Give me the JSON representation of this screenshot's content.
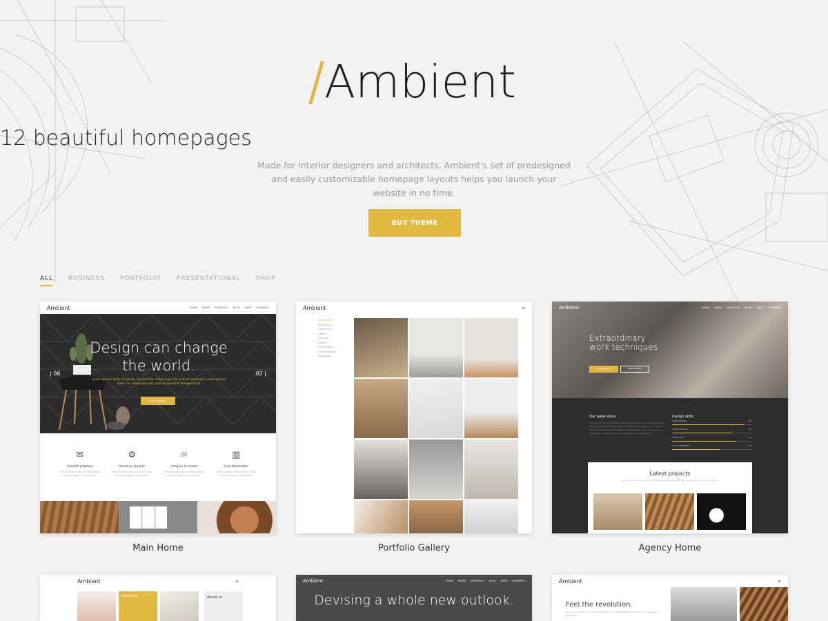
{
  "logo": "Ambient",
  "tagline": "12 beautiful homepages",
  "description": "Made for interior designers and architects, Ambient's set of predesigned and easily customizable homepage layouts helps you launch your website in no time.",
  "buy_button": "BUY THEME",
  "filters": [
    "ALL",
    "BUSINESS",
    "PORTFOLIO",
    "PRESENTATIONAL",
    "SHOP"
  ],
  "colors": {
    "accent": "#e1b840",
    "background": "#f2f2f2",
    "dark": "#2d2d2d"
  },
  "cards": [
    {
      "caption": "Main Home",
      "brand": "Ambient",
      "nav": [
        "HOME",
        "PAGES",
        "PORTFOLIO",
        "BLOG",
        "SHOP",
        "ELEMENTS"
      ],
      "hero_title": "Design can change the world.",
      "hero_sub": "Lorem ipsum dolor sit amet, consectetur adipiscing elit, sed do eiusmod. Lorem ipsum dolor Tur adipiscing elit, sed do eiusmod tempor incid",
      "hero_btn": "VIEW PROJECTS",
      "slide_left": "| 06",
      "slide_right": "02 |",
      "features": [
        {
          "icon": "envelope-icon",
          "title": "Smooth parallax",
          "text": "Proin gravida nibh vel velit auctor aliquet. Aenean sollicitudin."
        },
        {
          "icon": "gear-icon",
          "title": "Amazing layouts",
          "text": "Proin gravida nibh vel velit auctor aliquet. Aenean sollicitudin."
        },
        {
          "icon": "bulb-icon",
          "title": "Imagine & create",
          "text": "Proin gravida nibh vel velit auctor aliquet. Aenean sollicitudin."
        },
        {
          "icon": "building-icon",
          "title": "Cool shortcodes",
          "text": "Proin gravida nibh vel velit auctor aliquet. Aenean sollicitudin."
        }
      ]
    },
    {
      "caption": "Portfolio Gallery",
      "brand": "Ambient",
      "menu": [
        "Apartments",
        "Restaurant",
        "Cafe Stores",
        "Offices",
        "Dinerner",
        "Salons",
        "Public Space",
        "Contact House",
        "Showroom"
      ]
    },
    {
      "caption": "Agency Home",
      "brand": "Ambient",
      "nav": [
        "HOME",
        "PAGES",
        "PORTFOLIO",
        "BLOG",
        "SHOP",
        "ELEMENTS"
      ],
      "hero_title": "Extraordinary work techniques",
      "btn1": "VIEW PROJECTS",
      "btn2": "VIEW FEATURES",
      "story_title": "Our great story",
      "story_text": "Lorem ipsum dolor sit amet, consectetur adipiscing elit, sed do eiusmod tempor incididunt ut labore et dolore magna aliqua. Ut enim ad minim veniam, quis nostrud exercitation ullamco laboris nisi ut aliquip ex ea commodo consequat. Duis aute irure dolor in reprehenderit.",
      "skills_title": "Design skills",
      "skills": [
        {
          "label": "HOME PARTNERS",
          "value": "90%",
          "level": 0.9
        },
        {
          "label": "HOME ELEGANCE",
          "value": "75%",
          "level": 0.75
        },
        {
          "label": "HOME DESIGN",
          "value": "80%",
          "level": 0.8
        },
        {
          "label": "CALL US RESIDENCE",
          "value": "60%",
          "level": 0.6
        }
      ],
      "latest_title": "Latest projects",
      "latest_sub": "Lorem ipsum dolor sit amet, consectetur adipiscing elit, sed do eiusmod tempor incididunt"
    },
    {
      "brand": "Ambient",
      "tile_label": "Creativity",
      "about": "About us"
    },
    {
      "brand": "Ambient",
      "nav": [
        "HOME",
        "PAGES",
        "PORTFOLIO",
        "BLOG",
        "SHOP",
        "ELEMENTS"
      ],
      "title": "Devising a whole new outlook."
    },
    {
      "brand": "Ambient",
      "title": "Feel the revolution.",
      "text": "Sed ut perspiciatis unde omnis iste natus error sit voluptatem accusantium doloremque laudantium."
    }
  ]
}
